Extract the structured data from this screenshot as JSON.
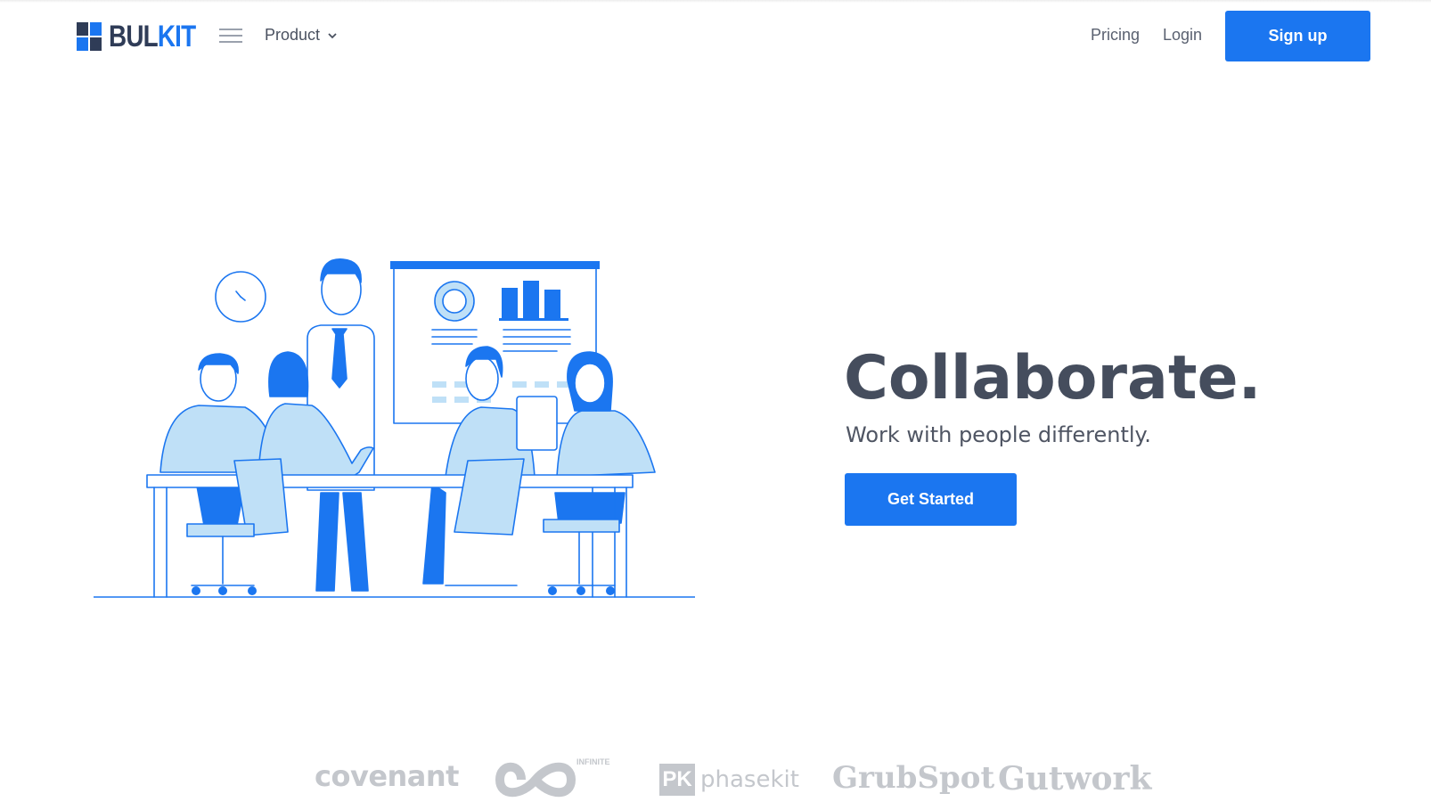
{
  "brand": {
    "name_part1": "BUL",
    "name_part2": "KIT",
    "primary_color": "#1b76f0",
    "dark_color": "#2f3c57"
  },
  "nav": {
    "menu_icon": "hamburger-icon",
    "product_label": "Product",
    "product_icon": "chevron-down-icon",
    "pricing_label": "Pricing",
    "login_label": "Login",
    "signup_label": "Sign up"
  },
  "hero": {
    "title": "Collaborate.",
    "subtitle": "Work with people differently.",
    "cta_label": "Get Started",
    "illustration": "team-meeting-illustration"
  },
  "clients": {
    "covenant": "covenant",
    "infinite": "INFINITE",
    "phasekit_mark": "PK",
    "phasekit": "phasekit",
    "grubspot": "GrubSpot",
    "gutwork": "Gutwork",
    "logo_color": "#c4c7cc"
  }
}
